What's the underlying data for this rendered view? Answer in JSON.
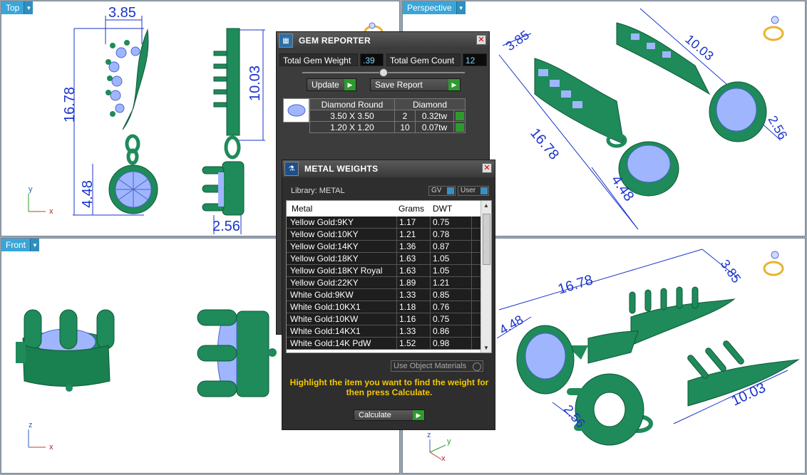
{
  "viewports": {
    "top": {
      "label": "Top",
      "dims": [
        "3.85",
        "16.78",
        "10.03",
        "4.48",
        "2.56"
      ],
      "axes": [
        "y",
        "x"
      ]
    },
    "perspective": {
      "label": "Perspective",
      "dims": [
        "3.85",
        "10.03",
        "16.78",
        "4.48",
        "2.56"
      ]
    },
    "front": {
      "label": "Front",
      "axes": [
        "z",
        "x"
      ]
    },
    "perspective2": {
      "dims": [
        "16.78",
        "3.85",
        "4.48",
        "10.03",
        "2.56"
      ],
      "axes": [
        "y",
        "z",
        "x"
      ]
    }
  },
  "gem_reporter": {
    "title": "GEM REPORTER",
    "total_weight_label": "Total Gem Weight",
    "total_weight_value": ".39",
    "total_count_label": "Total Gem Count",
    "total_count_value": "12",
    "update_label": "Update",
    "save_label": "Save Report",
    "gem_type": "Diamond Round",
    "gem_material": "Diamond",
    "rows": [
      {
        "size": "3.50 X 3.50",
        "count": "2",
        "tw": "0.32tw"
      },
      {
        "size": "1.20 X 1.20",
        "count": "10",
        "tw": "0.07tw"
      }
    ]
  },
  "metal_weights": {
    "title": "METAL WEIGHTS",
    "library_label": "Library: METAL",
    "gv_label": "GV",
    "user_label": "User",
    "columns": [
      "Metal",
      "Grams",
      "DWT"
    ],
    "rows": [
      {
        "metal": "Yellow Gold:9KY",
        "grams": "1.17",
        "dwt": "0.75"
      },
      {
        "metal": "Yellow Gold:10KY",
        "grams": "1.21",
        "dwt": "0.78"
      },
      {
        "metal": "Yellow Gold:14KY",
        "grams": "1.36",
        "dwt": "0.87"
      },
      {
        "metal": "Yellow Gold:18KY",
        "grams": "1.63",
        "dwt": "1.05"
      },
      {
        "metal": "Yellow Gold:18KY Royal",
        "grams": "1.63",
        "dwt": "1.05"
      },
      {
        "metal": "Yellow Gold:22KY",
        "grams": "1.89",
        "dwt": "1.21"
      },
      {
        "metal": "White Gold:9KW",
        "grams": "1.33",
        "dwt": "0.85"
      },
      {
        "metal": "White Gold:10KX1",
        "grams": "1.18",
        "dwt": "0.76"
      },
      {
        "metal": "White Gold:10KW",
        "grams": "1.16",
        "dwt": "0.75"
      },
      {
        "metal": "White Gold:14KX1",
        "grams": "1.33",
        "dwt": "0.86"
      },
      {
        "metal": "White Gold:14K PdW",
        "grams": "1.52",
        "dwt": "0.98"
      }
    ],
    "use_object_materials": "Use Object Materials",
    "hint": "Highlight the item you want to find the weight for then press Calculate.",
    "calculate_label": "Calculate"
  },
  "colors": {
    "model_green": "#1f8a5a",
    "gem_blue": "#9fb6ff",
    "dim_blue": "#1a33cc",
    "tab_blue": "#3aa6d8"
  }
}
